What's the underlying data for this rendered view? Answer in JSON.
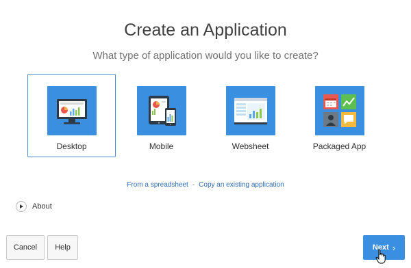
{
  "header": {
    "title": "Create an Application",
    "subtitle": "What type of application would you like to create?"
  },
  "app_types": [
    {
      "label": "Desktop",
      "icon": "desktop-monitor-icon",
      "selected": true
    },
    {
      "label": "Mobile",
      "icon": "mobile-devices-icon",
      "selected": false
    },
    {
      "label": "Websheet",
      "icon": "websheet-icon",
      "selected": false
    },
    {
      "label": "Packaged App",
      "icon": "packaged-app-icon",
      "selected": false
    }
  ],
  "links": {
    "spreadsheet": "From a spreadsheet",
    "separator": "-",
    "copy": "Copy an existing application"
  },
  "about": {
    "label": "About"
  },
  "footer": {
    "cancel_label": "Cancel",
    "help_label": "Help",
    "next_label": "Next"
  },
  "colors": {
    "accent": "#3b8fe0",
    "selected_border": "#4a8fd6",
    "link": "#2c6bb5"
  }
}
